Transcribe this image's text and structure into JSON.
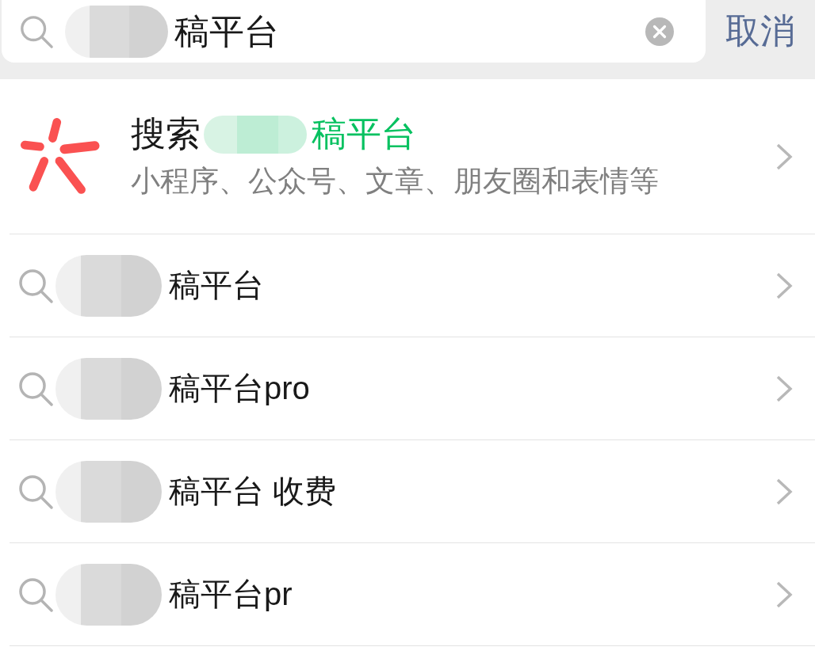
{
  "search_bar": {
    "value": "稿平台",
    "redacted": true,
    "cancel": "取消"
  },
  "search_all": {
    "prefix": "搜索",
    "query": "稿平台",
    "redacted": true,
    "subtitle": "小程序、公众号、文章、朋友圈和表情等"
  },
  "suggestions": [
    {
      "text": "稿平台",
      "redacted": true
    },
    {
      "text": "稿平台pro",
      "redacted": true
    },
    {
      "text": "稿平台 收费",
      "redacted": true
    },
    {
      "text": "稿平台pr",
      "redacted": true
    }
  ]
}
